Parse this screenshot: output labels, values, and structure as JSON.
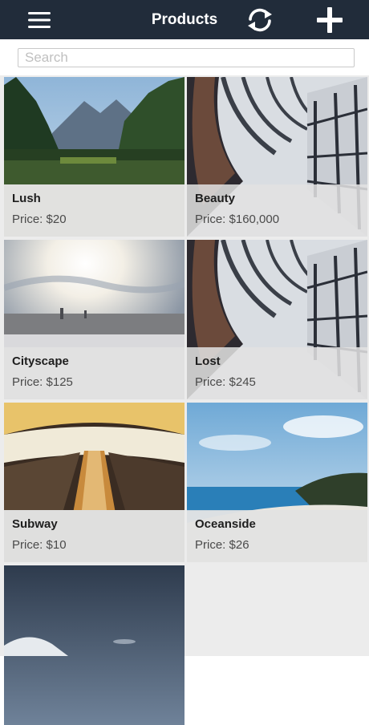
{
  "header": {
    "title": "Products",
    "menu_icon": "hamburger-menu-icon",
    "refresh_icon": "refresh-icon",
    "add_icon": "plus-icon"
  },
  "search": {
    "placeholder": "Search",
    "value": ""
  },
  "products": [
    {
      "name": "Lush",
      "price": "Price: $20",
      "image": "forest-lake-mountains"
    },
    {
      "name": "Beauty",
      "price": "Price: $160,000",
      "image": "library-dome"
    },
    {
      "name": "Cityscape",
      "price": "Price: $125",
      "image": "city-sunset"
    },
    {
      "name": "Lost",
      "price": "Price: $245",
      "image": "library-dome"
    },
    {
      "name": "Subway",
      "price": "Price: $10",
      "image": "subway-escalator"
    },
    {
      "name": "Oceanside",
      "price": "Price: $26",
      "image": "ocean-coast"
    },
    {
      "name": "",
      "price": "",
      "image": "night-sky-snow"
    }
  ],
  "colors": {
    "header_bg": "#212c3a",
    "grid_bg": "#ececec"
  }
}
